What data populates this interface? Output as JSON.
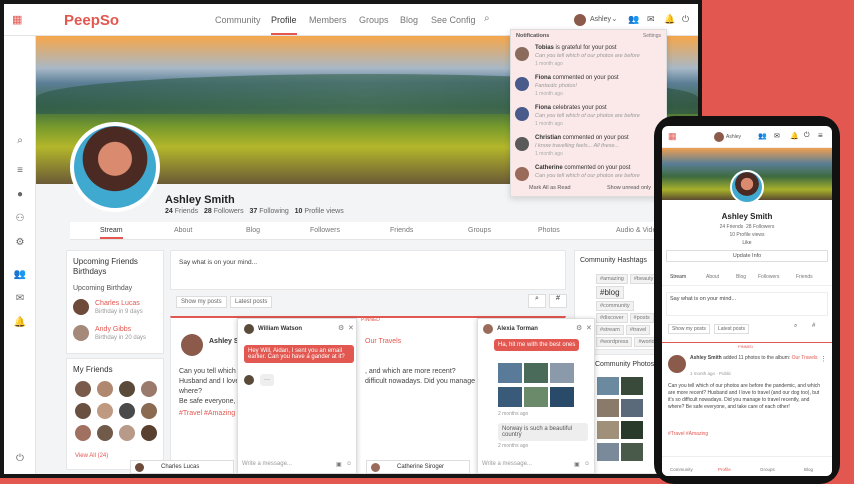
{
  "colors": {
    "accent": "#e25750"
  },
  "nav": {
    "logo": "PeepSo",
    "items": [
      "Community",
      "Profile",
      "Members",
      "Groups",
      "Blog",
      "See Config"
    ],
    "user": "Ashley"
  },
  "profile": {
    "name": "Ashley Smith",
    "friends": "24",
    "friends_label": "Friends",
    "followers": "28",
    "followers_label": "Followers",
    "following": "37",
    "following_label": "Following",
    "views": "10",
    "views_label": "Profile views"
  },
  "tabs": [
    "Stream",
    "About",
    "Blog",
    "Followers",
    "Friends",
    "Groups",
    "Photos",
    "Audio & Video"
  ],
  "birthdays": {
    "title": "Upcoming Friends Birthdays",
    "sub": "Upcoming Birthday",
    "people": [
      {
        "name": "Charles Lucas",
        "date": "Birthday in 9 days"
      },
      {
        "name": "Andy Gibbs",
        "date": "Birthday in 20 days"
      }
    ]
  },
  "friends_card": {
    "title": "My Friends",
    "view_all": "View All (24)"
  },
  "postbox": {
    "placeholder": "Say what is on your mind...",
    "show": "Show my posts",
    "latest": "Latest posts"
  },
  "post": {
    "author": "Ashley Sm",
    "text1": "Can you tell which",
    "text2": "Husband and I love",
    "text3": "where?",
    "text4": "Be safe everyone, a",
    "tags": "#Travel #Amazing",
    "pinned": "PINNED",
    "text_right1": "Our Travels",
    "text_right2": ", and which are more recent?",
    "text_right3": "difficult nowadays. Did you manage t"
  },
  "hashtags": {
    "title": "Community Hashtags",
    "list": [
      "#amazing",
      "#beauty",
      "#blog",
      "#community",
      "#discover",
      "#posts",
      "#stream",
      "#travel",
      "#wordpress",
      "#world"
    ]
  },
  "community_photos": {
    "title": "Community Photos"
  },
  "notifications": {
    "title": "Notifications",
    "settings": "Settings",
    "items": [
      {
        "name": "Tobias",
        "action": " is grateful for your post",
        "snip": "Can you tell which of our photos are before",
        "time": "1 month ago"
      },
      {
        "name": "Fiona",
        "action": " commented on your post",
        "snip": "Fantastic photos!",
        "time": "1 month ago"
      },
      {
        "name": "Fiona",
        "action": " celebrates your post",
        "snip": "Can you tell which of our photos are before",
        "time": "1 month ago"
      },
      {
        "name": "Christian",
        "action": " commented on your post",
        "snip": "I know travelling feels... All these...",
        "time": "1 month ago"
      },
      {
        "name": "Catherine",
        "action": " commented on your post",
        "snip": "Can you tell which of our photos are before",
        "time": "1 month ago"
      }
    ],
    "mark": "Mark All as Read",
    "unread": "Show unread only"
  },
  "chat1": {
    "name": "William Watson",
    "msg1": "Hey Will, Aidan, I sent you an email earlier. Can you have a gander at it?",
    "placeholder": "Write a message..."
  },
  "chat2": {
    "name": "Alexia Torman",
    "msg1": "Ha, hit me with the best ones",
    "msg2": "Norway is such a beautiful country",
    "time": "2 months ago",
    "placeholder": "Write a message..."
  },
  "bottom_chats": [
    "Charles Lucas",
    "Catherine Siroger"
  ],
  "phone": {
    "name": "Ashley Smith",
    "stats1": "24 Friends",
    "stats2": "28 Followers",
    "stats3": "10 Profile views",
    "like": "Like",
    "update": "Update Info",
    "tabs": [
      "Stream",
      "About",
      "Blog",
      "Followers",
      "Friends"
    ],
    "say": "Say what is on your mind...",
    "show": "Show my posts",
    "latest": "Latest posts",
    "pinned": "PINNED",
    "post_author": "Ashley Smith",
    "post_action": " added 11 photos to the album: ",
    "post_album": "Our Travels",
    "post_time": "1 month ago",
    "post_privacy": "Public",
    "post_text": "Can you tell which of our photos are before the pandemic, and which are more recent? Husband and I love to travel (and our dog too), but it's so difficult nowadays. Did you manage to travel recently, and where? Be safe everyone, and take care of each other!",
    "tags": "#Travel #Amazing",
    "bottom": [
      "Community",
      "Profile",
      "Groups",
      "Blog"
    ]
  }
}
